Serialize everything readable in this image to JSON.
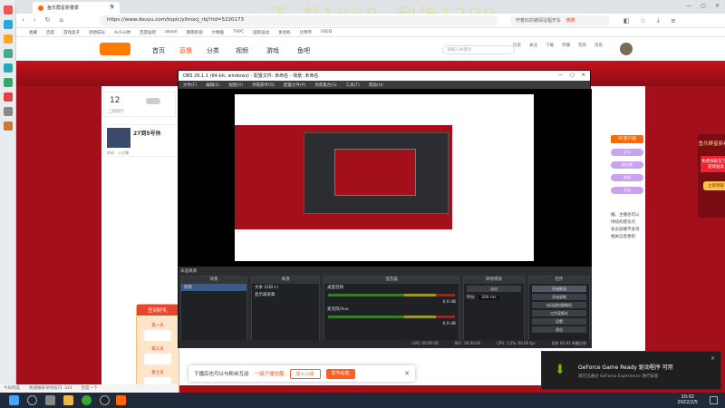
{
  "browser": {
    "tab_title": "鱼乐群星新春季",
    "url": "https://www.douyu.com/topic/yllmxcj_rbj?rid=5220173",
    "search_placeholder": "开着红的被闹征程开车",
    "search_badge": "热搜",
    "overlay_text": "下 书1008, 刮指1299",
    "bookmarks": [
      "收藏",
      "百度",
      "游戏盒子",
      "思想成长",
      "AcFun弹",
      "百度贴吧",
      "abalol",
      "网络影视",
      "大数据",
      "THPC",
      "国际运动",
      "发动机",
      "比特币",
      "IOOD"
    ]
  },
  "site": {
    "nav": [
      "首页",
      "直播",
      "分类",
      "视频",
      "游戏",
      "鱼吧"
    ],
    "search_placeholder": "请输入关键词",
    "header_icons": [
      "历史",
      "关注",
      "下载",
      "开播",
      "签到",
      "消息"
    ],
    "fans_count": "12",
    "fans_label": "上周排行",
    "room_title": "27到5号休",
    "room_tags": [
      "热线",
      "小主播"
    ],
    "right_banner": "PC客户端",
    "ad_title": "鱼乐群星新春季",
    "ad_sub": "免费领取百万份游戏道具",
    "ad_btn": "立即领取",
    "checkin_title": "签到好礼",
    "checkin_days": [
      "第一天",
      "第三天",
      "第七天"
    ],
    "notice_text": "下播后也可以与粉丝互动",
    "notice_link": "一键开播提醒",
    "notice_btn1": "加入小组",
    "notice_btn2": "发布动态",
    "right_pills": [
      "月卡",
      "粉丝牌",
      "贵族",
      "活动"
    ],
    "description_lines": [
      "播。主播也可以",
      "持续的建功点",
      "会员加播不会消",
      "相关信息更新"
    ]
  },
  "obs": {
    "title": "OBS 26.1.1 (64-bit, windows) - 配置文件: 未命名 - 场景: 未命名",
    "menu": [
      "文件(F)",
      "编辑(E)",
      "视图(V)",
      "停靠部件(D)",
      "配置文件(P)",
      "场景集合(S)",
      "工具(T)",
      "帮助(H)"
    ],
    "source_hint": "未选择源",
    "docks": {
      "scenes": "场景",
      "sources": "来源",
      "mixer": "混音器",
      "transitions": "转场特效",
      "controls": "控件"
    },
    "scene_name": "场景",
    "sources": [
      "文本 (GDI+)",
      "显示器采集"
    ],
    "mixer_tracks": [
      {
        "name": "桌面音频",
        "level": "0.0 dB"
      },
      {
        "name": "麦克风/Aux",
        "level": "0.0 dB"
      }
    ],
    "transition_type": "淡出",
    "transition_duration_label": "时长",
    "transition_duration": "300 ms",
    "controls": [
      "开始推流",
      "开始录制",
      "启动虚拟摄像机",
      "工作室模式",
      "设置",
      "退出"
    ],
    "status": {
      "live": "LIVE: 00:00:00",
      "rec": "REC: 00:00:00",
      "cpu": "CPU: 1.2%, 60.00 fps",
      "dropped": "丢弃 (0) 61 的最后帧"
    }
  },
  "geforce": {
    "title": "GeForce Game Ready 驱动程序 可用",
    "subtitle": "现在已通过 GeForce Experience 进行安装"
  },
  "taskbar": {
    "time": "10:02",
    "date": "2022/2/5"
  },
  "status_bottom": [
    "今日优选",
    "快速做表单的技巧: 333",
    "百度一下"
  ],
  "colors": {
    "site_red": "#a3101a",
    "obs_dark": "#2b2d31",
    "nvidia_green": "#76b900",
    "accent_orange": "#ff5d23"
  }
}
